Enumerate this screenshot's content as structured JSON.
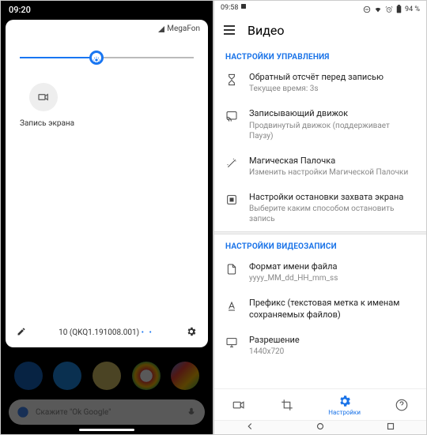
{
  "left": {
    "time": "09:20",
    "carrier": "MegaFon",
    "tile_label": "Запись экрана",
    "build": "10 (QKQ1.191008.001)",
    "dots": "• •",
    "search_hint": "Скажите \"Ok Google\""
  },
  "right": {
    "time": "09:58",
    "battery": "94 %",
    "title": "Видео",
    "sec1": "НАСТРОЙКИ УПРАВЛЕНИЯ",
    "items1": [
      {
        "t": "Обратный отсчёт перед записью",
        "s": "Текущее время: 3s"
      },
      {
        "t": "Записывающий движок",
        "s": "Продвинутый движок (поддерживает Паузу)"
      },
      {
        "t": "Магическая Палочка",
        "s": "Изменить настройки Магической Палочки"
      },
      {
        "t": "Настройки остановки захвата экрана",
        "s": "Выберите каким способом остановить запись"
      }
    ],
    "sec2": "НАСТРОЙКИ ВИДЕОЗАПИСИ",
    "items2": [
      {
        "t": "Формат имени файла",
        "s": "yyyy_MM_dd_HH_mm_ss"
      },
      {
        "t": "Префикс (текстовая метка к именам сохраняемых файлов)",
        "s": ""
      },
      {
        "t": "Разрешение",
        "s": "1440x720"
      }
    ],
    "bn_active": "Настройки"
  }
}
